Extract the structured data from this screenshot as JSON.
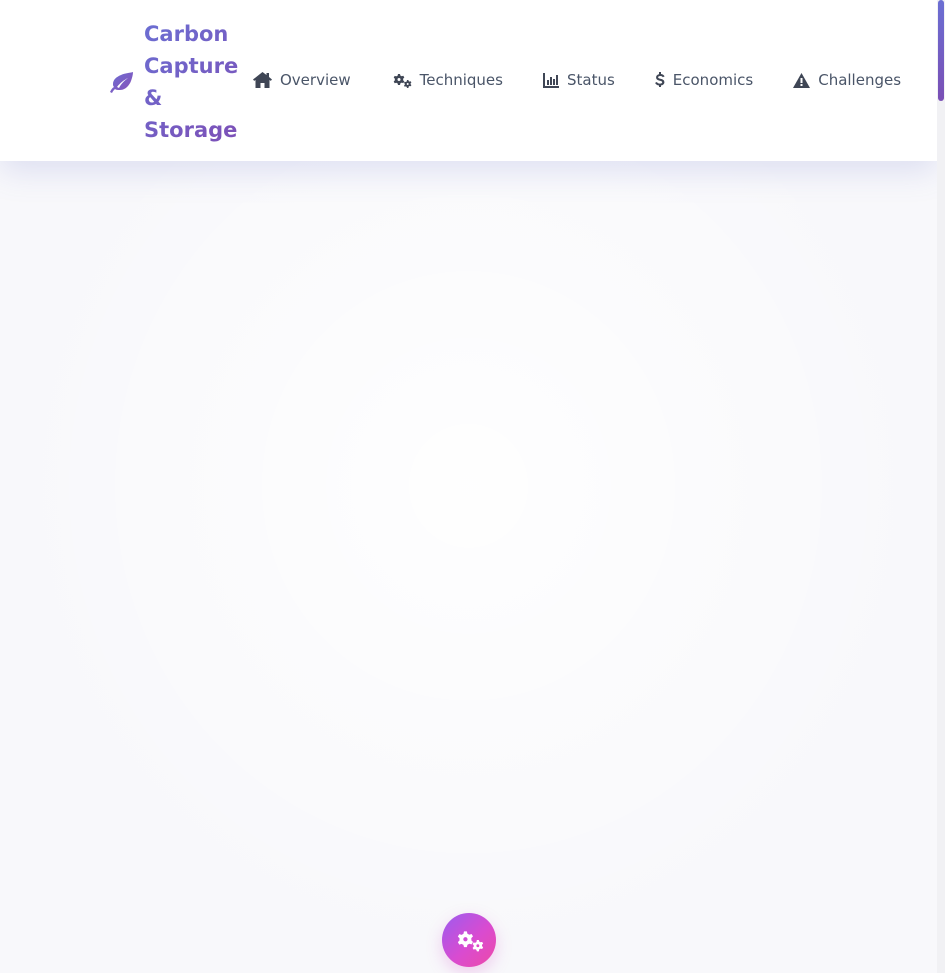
{
  "brand": {
    "icon": "leaf-icon",
    "title": "Carbon Capture & Storage"
  },
  "nav": {
    "items": [
      {
        "label": "Overview",
        "icon": "home-icon"
      },
      {
        "label": "Techniques",
        "icon": "cogs-icon"
      },
      {
        "label": "Status",
        "icon": "chart-bar-icon"
      },
      {
        "label": "Economics",
        "icon": "dollar-icon"
      },
      {
        "label": "Challenges",
        "icon": "warning-icon"
      }
    ]
  },
  "fab": {
    "icon": "cogs-icon"
  },
  "colors": {
    "accent_start": "#6b6fd3",
    "accent_end": "#7d4fb6",
    "fab_start": "#9b5cf0",
    "fab_end": "#ee4aa7",
    "nav_text": "#4a5568"
  }
}
